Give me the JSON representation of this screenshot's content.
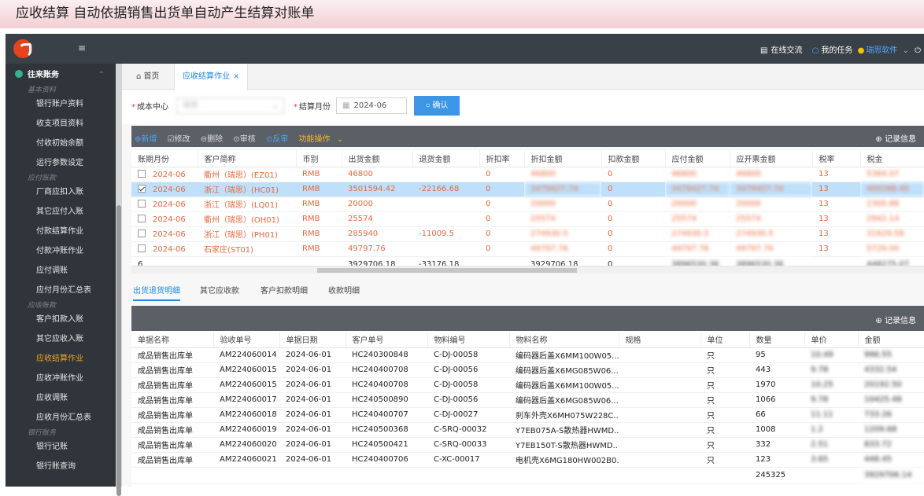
{
  "banner": {
    "text": "应收结算 自动依据销售出货单自动产生结算对账单"
  },
  "topbar": {
    "online_chat": "在线交流",
    "my_tasks": "我的任务",
    "user": "瑞思软件"
  },
  "sidebar": {
    "group": "往来账务",
    "sections": [
      {
        "title": "基本资料",
        "items": [
          "银行账户资料",
          "收支项目资料",
          "付收初始余额",
          "运行参数设定"
        ]
      },
      {
        "title": "应付账款",
        "items": [
          "厂商应扣入账",
          "其它应付入账",
          "付款结算作业",
          "付款冲账作业",
          "应付调账",
          "应付月份汇总表"
        ]
      },
      {
        "title": "应收账款",
        "items": [
          "客户扣款入账",
          "其它应收入账",
          "应收结算作业",
          "应收冲账作业",
          "应收调账",
          "应收月份汇总表"
        ]
      },
      {
        "title": "银行账务",
        "items": [
          "银行记账",
          "银行账查询"
        ]
      }
    ],
    "active_item": "应收结算作业"
  },
  "tabs": {
    "home": "首页",
    "active": "应收结算作业"
  },
  "form": {
    "cost_center_label": "成本中心",
    "cost_center_value": "瑞思",
    "month_label": "结算月份",
    "month_value": "2024-06",
    "confirm": "确认"
  },
  "toolbar1": {
    "new": "新增",
    "edit": "修改",
    "delete": "删除",
    "audit": "审核",
    "unaudit": "反审",
    "functions": "功能操作",
    "records": "记录信息"
  },
  "grid1": {
    "headers": [
      "账期月份",
      "客户简称",
      "币别",
      "出货金额",
      "退货金额",
      "折扣率",
      "折扣金额",
      "扣款金额",
      "应付金额",
      "应开票金额",
      "税率",
      "税金"
    ],
    "rows": [
      [
        "2024-06",
        "衢州（瑞思）(EZ01)",
        "RMB",
        "46800",
        "",
        "0",
        "46800",
        "0",
        "46800",
        "46800",
        "13",
        "5384.07"
      ],
      [
        "2024-06",
        "浙江（瑞思）(HC01)",
        "RMB",
        "3501594.42",
        "-22166.68",
        "0",
        "3479427.74",
        "0",
        "3479427.74",
        "3479427.74",
        "13",
        "400288.45"
      ],
      [
        "2024-06",
        "浙江（瑞思）(LQ01)",
        "RMB",
        "20000",
        "",
        "0",
        "20000",
        "0",
        "20000",
        "20000",
        "13",
        "2300.88"
      ],
      [
        "2024-06",
        "衢州（瑞思）(OH01)",
        "RMB",
        "25574",
        "",
        "0",
        "25574",
        "0",
        "25574",
        "25574",
        "13",
        "2942.14"
      ],
      [
        "2024-06",
        "浙江（瑞思）(PH01)",
        "RMB",
        "285940",
        "-11009.5",
        "0",
        "274930.5",
        "0",
        "274930.5",
        "274930.5",
        "13",
        "31629.58"
      ],
      [
        "2024-06",
        "石家庄(ST01)",
        "RMB",
        "49797.76",
        "",
        "0",
        "49797.76",
        "0",
        "49797.76",
        "49797.76",
        "13",
        "5729.00"
      ]
    ],
    "selected_row": 1,
    "footer": [
      "6",
      "",
      "",
      "3929706.18",
      "-33176.18",
      "",
      "3929706.18",
      "0",
      "3896530.36",
      "3896530.36",
      "",
      "448275.07"
    ]
  },
  "subtabs": [
    "出货退货明细",
    "其它应收款",
    "客户扣款明细",
    "收款明细"
  ],
  "toolbar2": {
    "records": "记录信息"
  },
  "grid2": {
    "headers": [
      "单据名称",
      "验收单号",
      "单据日期",
      "客户单号",
      "物料编号",
      "物料名称",
      "规格",
      "单位",
      "数量",
      "单价",
      "金额"
    ],
    "rows": [
      [
        "成品销售出库单",
        "AM224060014",
        "2024-06-01",
        "HC240300848",
        "C-DJ-00058",
        "编码器后盖X6MM100W05...",
        "",
        "只",
        "95",
        "10.49",
        "996.55"
      ],
      [
        "成品销售出库单",
        "AM224060015",
        "2024-06-01",
        "HC240400708",
        "C-DJ-00056",
        "编码器后盖X6MG085W06...",
        "",
        "只",
        "443",
        "9.78",
        "4332.54"
      ],
      [
        "成品销售出库单",
        "AM224060015",
        "2024-06-01",
        "HC240400708",
        "C-DJ-00058",
        "编码器后盖X6MM100W05...",
        "",
        "只",
        "1970",
        "10.25",
        "20192.50"
      ],
      [
        "成品销售出库单",
        "AM224060017",
        "2024-06-01",
        "HC240500890",
        "C-DJ-00056",
        "编码器后盖X6MG085W06...",
        "",
        "只",
        "1066",
        "9.78",
        "10425.48"
      ],
      [
        "成品销售出库单",
        "AM224060018",
        "2024-06-01",
        "HC240400707",
        "C-DJ-00027",
        "刹车外壳X6MH075W228C...",
        "",
        "只",
        "66",
        "11.11",
        "733.26"
      ],
      [
        "成品销售出库单",
        "AM224060019",
        "2024-06-01",
        "HC240500368",
        "C-SRQ-00032",
        "Y7EB075A-S散热器HWMD...",
        "",
        "只",
        "1008",
        "1.2",
        "1209.68"
      ],
      [
        "成品销售出库单",
        "AM224060020",
        "2024-06-01",
        "HC240500421",
        "C-SRQ-00033",
        "Y7EB150T-S散热器HWMD...",
        "",
        "只",
        "332",
        "2.51",
        "833.72"
      ],
      [
        "成品销售出库单",
        "AM224060021",
        "2024-06-01",
        "HC240400706",
        "C-XC-00017",
        "电机壳X6MG180HW002B0...",
        "",
        "只",
        "123",
        "3.65",
        "448.45"
      ]
    ],
    "footer": [
      "",
      "",
      "",
      "",
      "",
      "",
      "",
      "",
      "245325",
      "",
      "3929706.14"
    ]
  }
}
